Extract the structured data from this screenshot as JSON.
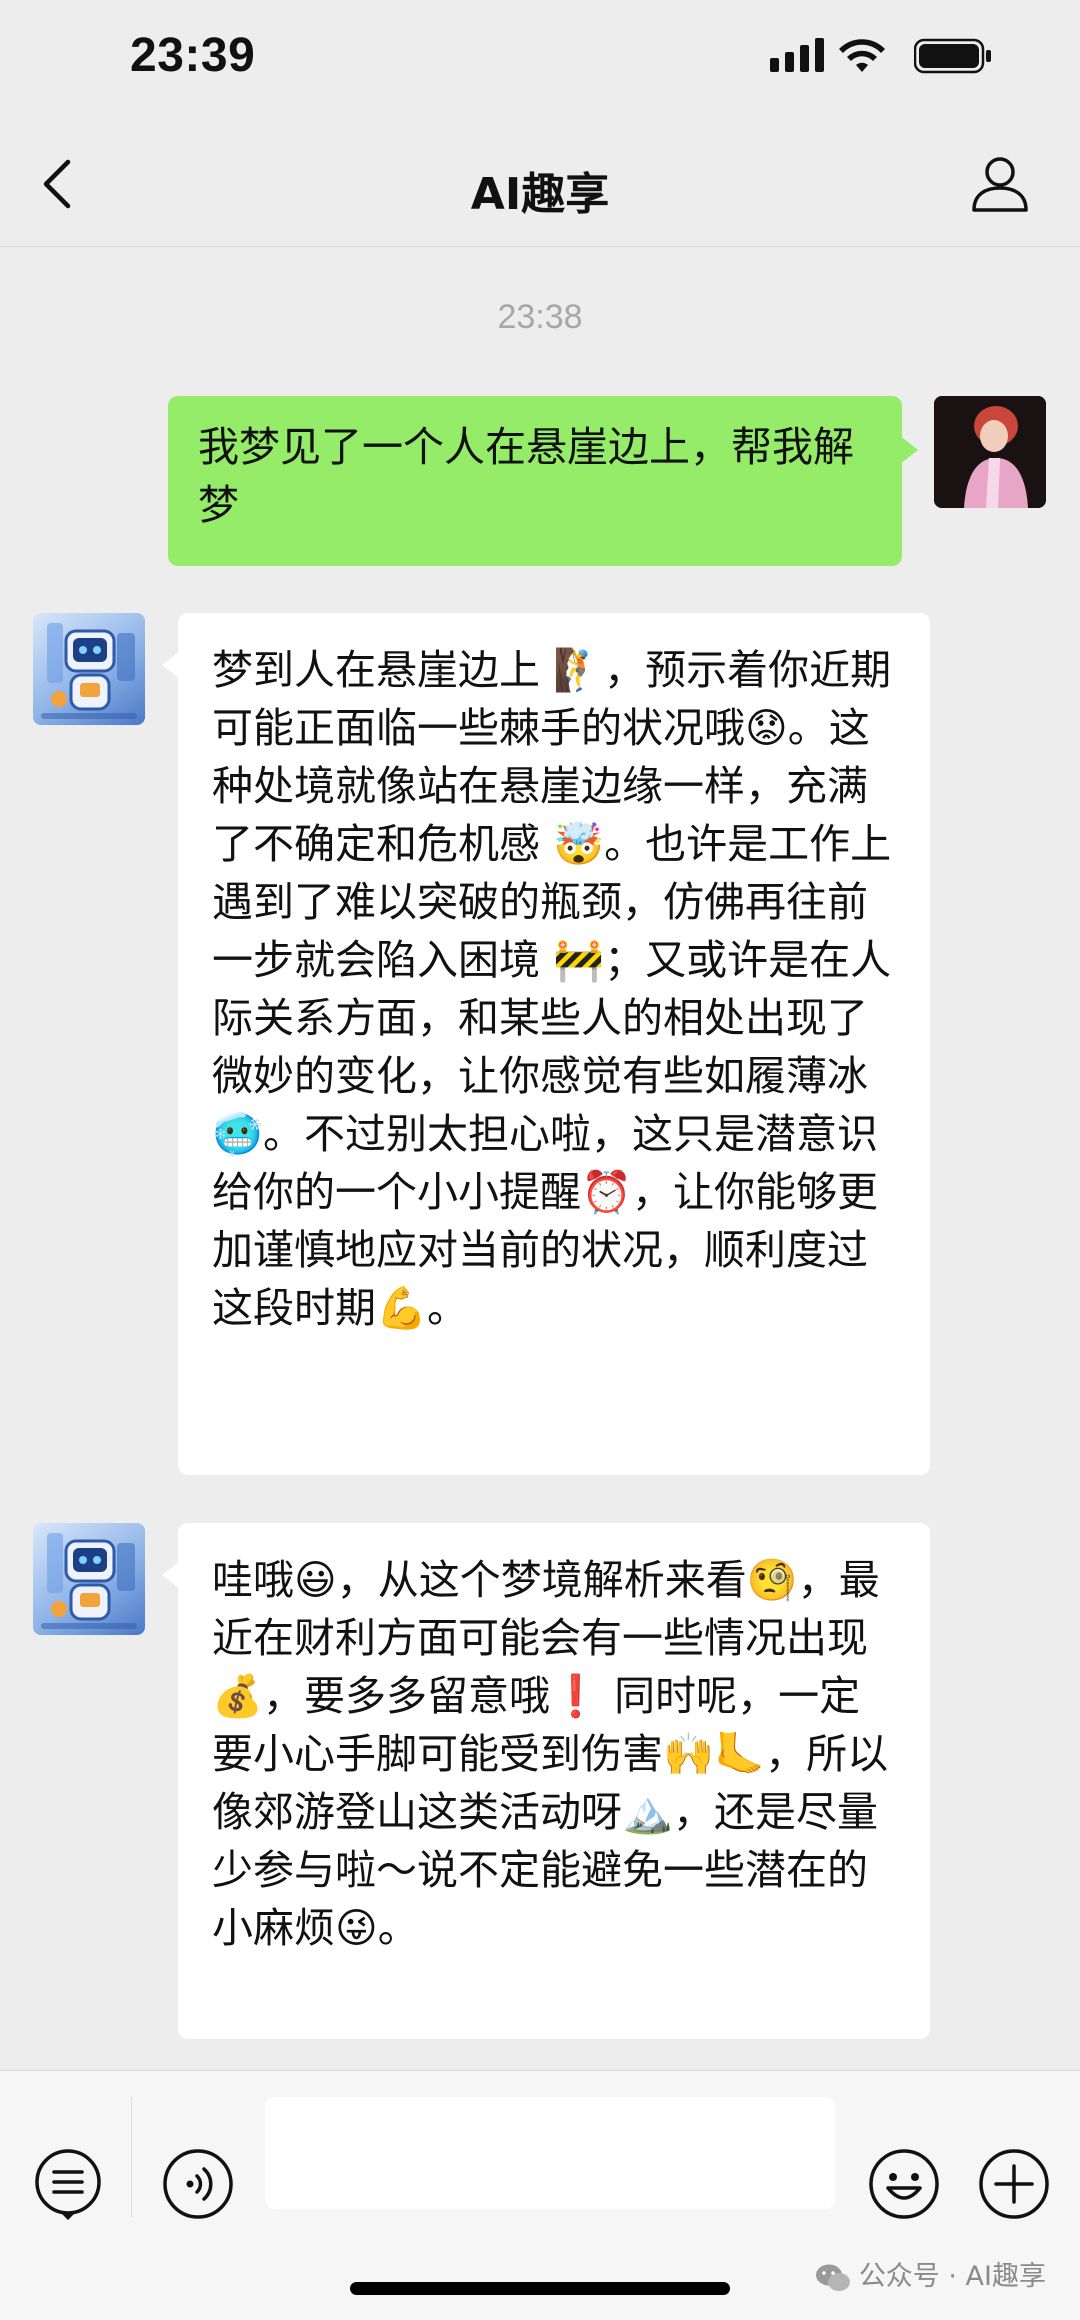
{
  "status_bar": {
    "time": "23:39"
  },
  "nav": {
    "title": "AI趣享"
  },
  "chat": {
    "timestamp": "23:38",
    "user_message": "我梦见了一个人在悬崖边上，帮我解梦",
    "bot_message_1": "梦到人在悬崖边上 🧗，预示着你近期可能正面临一些棘手的状况哦😟。这种处境就像站在悬崖边缘一样，充满了不确定和危机感 🤯。也许是工作上遇到了难以突破的瓶颈，仿佛再往前一步就会陷入困境 🚧；又或许是在人际关系方面，和某些人的相处出现了微妙的变化，让你感觉有些如履薄冰 🥶。不过别太担心啦，这只是潜意识给你的一个小小提醒⏰，让你能够更加谨慎地应对当前的状况，顺利度过这段时期💪。",
    "bot_message_2": "哇哦😃，从这个梦境解析来看🧐，最近在财利方面可能会有一些情况出现💰，要多多留意哦❗ 同时呢，一定要小心手脚可能受到伤害🙌🦶，所以像郊游登山这类活动呀🏔️，还是尽量少参与啦～说不定能避免一些潜在的小麻烦😜。"
  },
  "watermark": {
    "text": "公众号 · AI趣享"
  },
  "icons": {
    "back": "chevron-left-icon",
    "profile": "person-icon",
    "menu": "list-menu-icon",
    "voice": "voice-icon",
    "emoji": "smiley-icon",
    "plus": "plus-icon"
  },
  "colors": {
    "background": "#ededed",
    "user_bubble": "#95ec69",
    "bot_bubble": "#ffffff",
    "timestamp": "#a7a7a7"
  }
}
